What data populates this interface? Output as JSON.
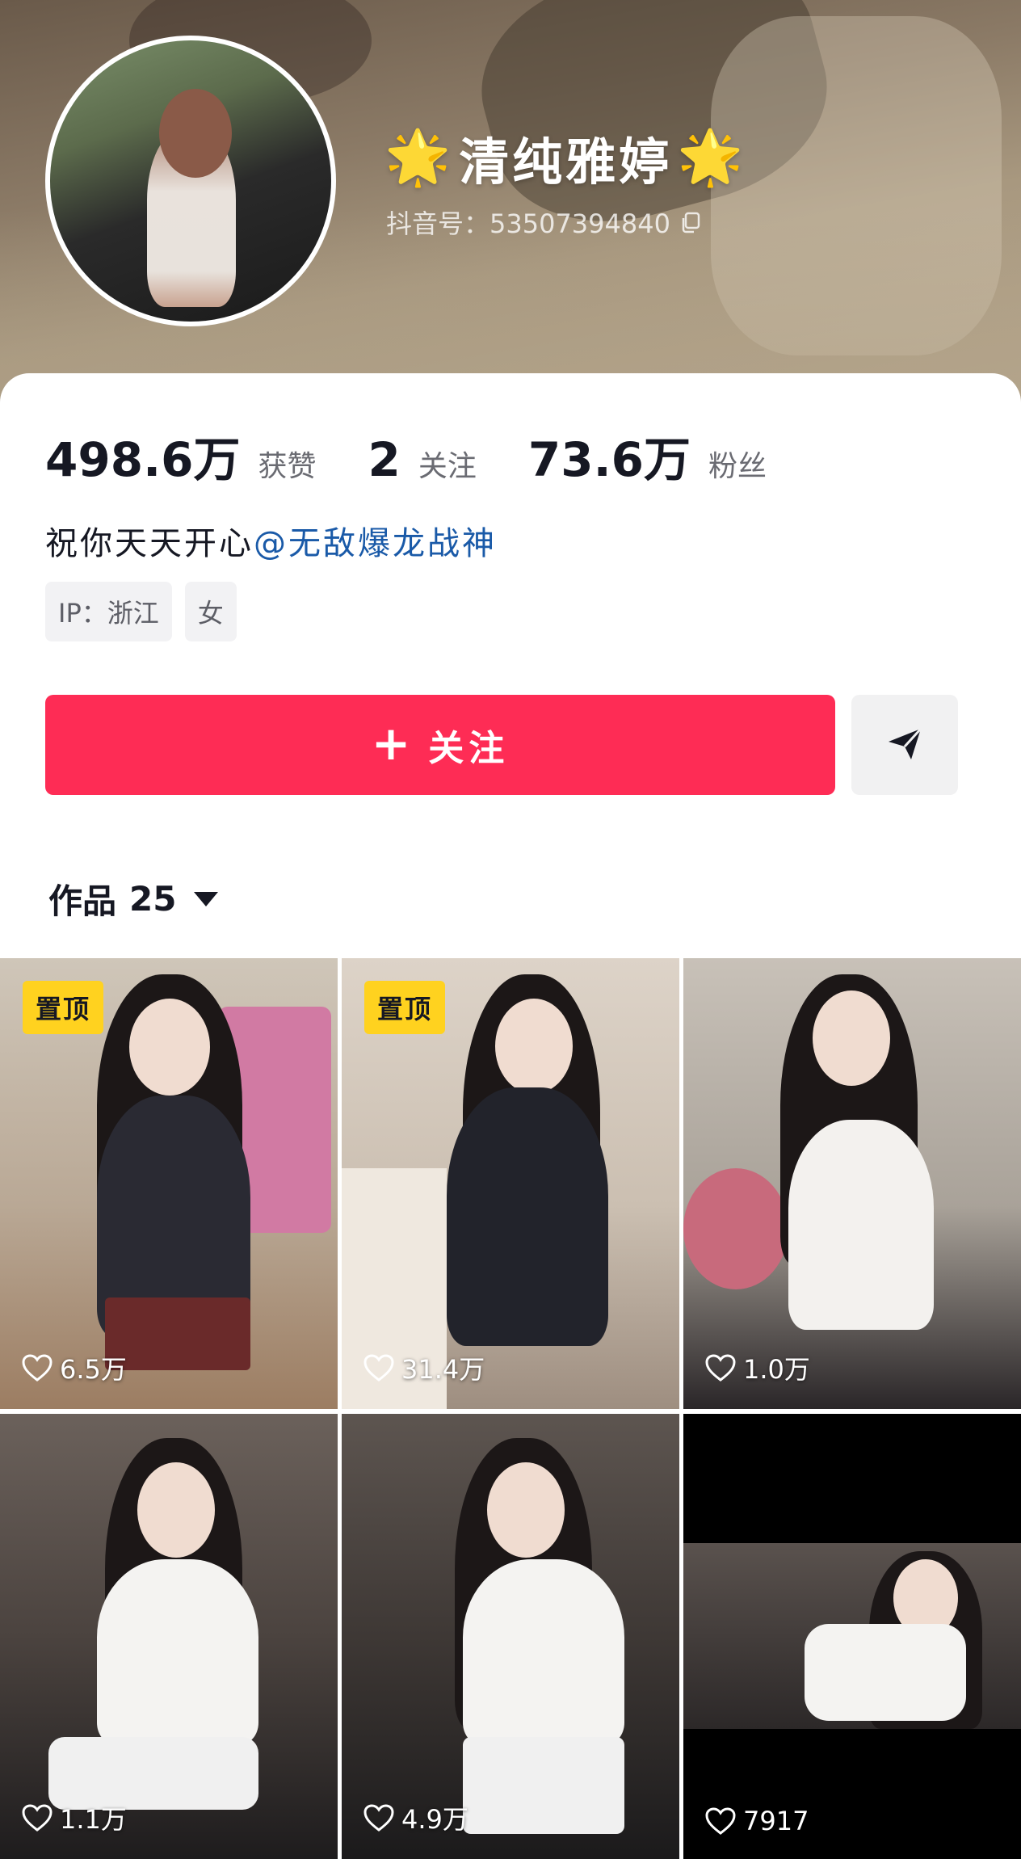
{
  "profile": {
    "name_star": "🌟",
    "name": "清纯雅婷",
    "douyin_id": "抖音号：53507394840"
  },
  "stats": {
    "likes_value": "498.6万",
    "likes_label": "获赞",
    "following_value": "2",
    "following_label": "关注",
    "followers_value": "73.6万",
    "followers_label": "粉丝"
  },
  "bio": {
    "text": "祝你天天开心",
    "mention": "@无敌爆龙战神"
  },
  "tags": [
    "IP：浙江",
    "女"
  ],
  "actions": {
    "follow_plus": "+",
    "follow_label": "关注"
  },
  "works": {
    "label": "作品",
    "count": "25"
  },
  "videos": [
    {
      "pinned": true,
      "pin_label": "置顶",
      "likes": "6.5万"
    },
    {
      "pinned": true,
      "pin_label": "置顶",
      "likes": "31.4万"
    },
    {
      "pinned": false,
      "likes": "1.0万"
    },
    {
      "pinned": false,
      "likes": "1.1万"
    },
    {
      "pinned": false,
      "likes": "4.9万"
    },
    {
      "pinned": false,
      "likes": "7917"
    }
  ],
  "colors": {
    "follow_button": "#fe2c55",
    "pin_badge": "#ffd21f",
    "mention": "#1a5aa8"
  },
  "icons": [
    "copy-icon",
    "send-icon",
    "heart-icon",
    "caret-down-icon"
  ]
}
